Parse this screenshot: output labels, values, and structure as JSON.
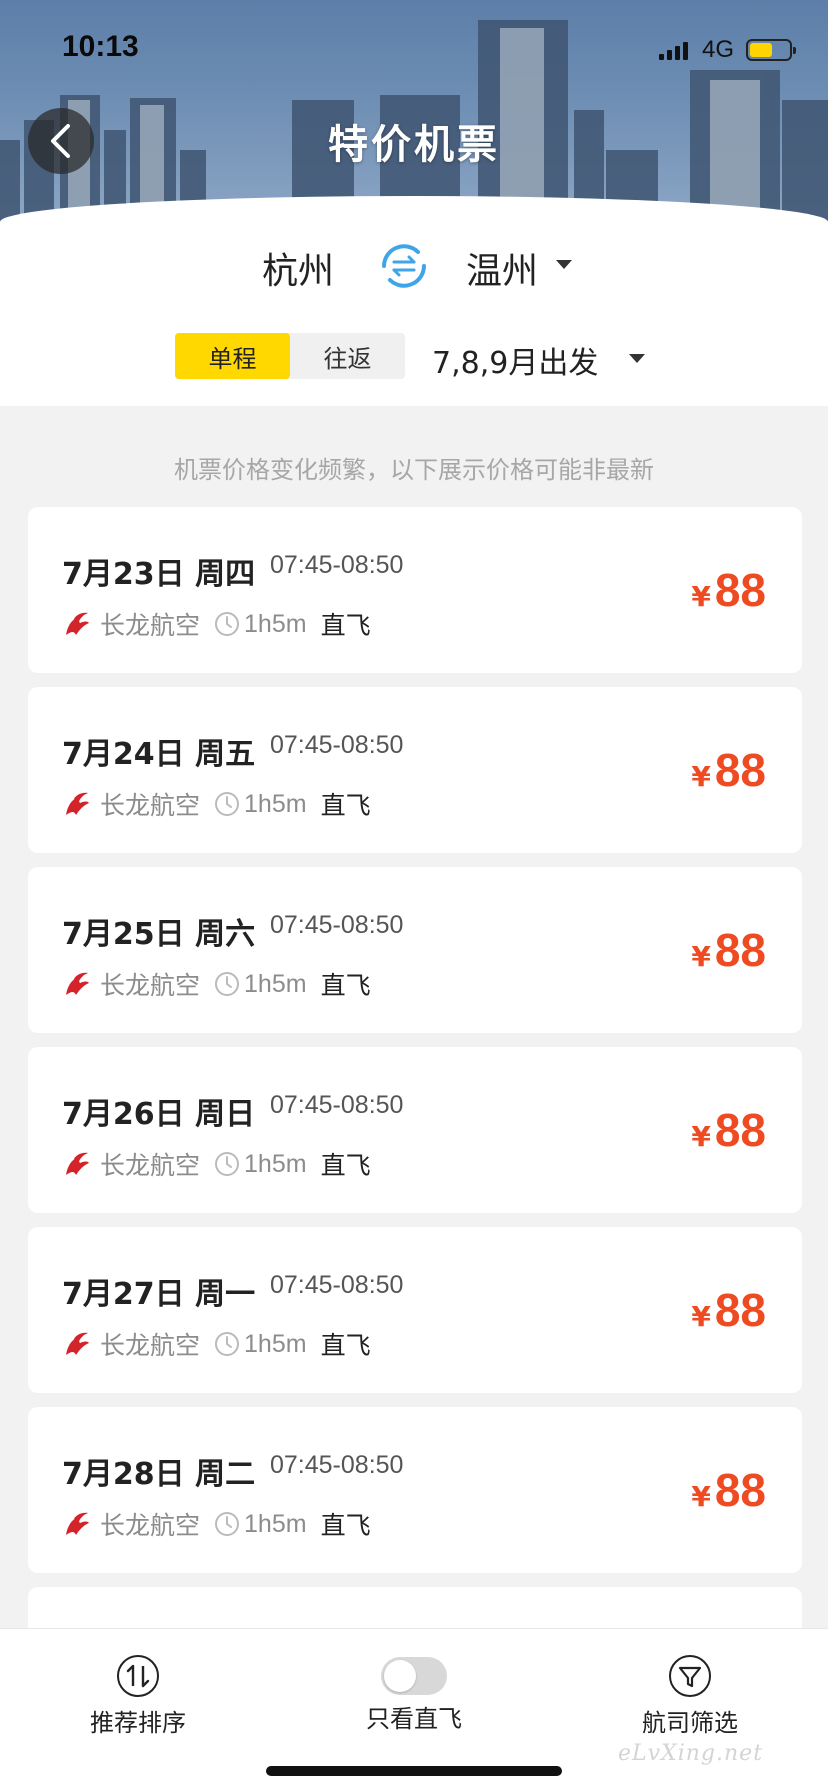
{
  "status_bar": {
    "time": "10:13",
    "network": "4G"
  },
  "header": {
    "title": "特价机票"
  },
  "route": {
    "from": "杭州",
    "to": "温州"
  },
  "trip_type": {
    "options": [
      "单程",
      "往返"
    ],
    "selected": "单程"
  },
  "departure": {
    "label": "7,8,9月出发"
  },
  "notice": "机票价格变化频繁，以下展示价格可能非最新",
  "flights": [
    {
      "date": "7月23日 周四",
      "time": "07:45-08:50",
      "airline": "长龙航空",
      "duration": "1h5m",
      "type": "直飞",
      "currency": "¥",
      "price": "88"
    },
    {
      "date": "7月24日 周五",
      "time": "07:45-08:50",
      "airline": "长龙航空",
      "duration": "1h5m",
      "type": "直飞",
      "currency": "¥",
      "price": "88"
    },
    {
      "date": "7月25日 周六",
      "time": "07:45-08:50",
      "airline": "长龙航空",
      "duration": "1h5m",
      "type": "直飞",
      "currency": "¥",
      "price": "88"
    },
    {
      "date": "7月26日 周日",
      "time": "07:45-08:50",
      "airline": "长龙航空",
      "duration": "1h5m",
      "type": "直飞",
      "currency": "¥",
      "price": "88"
    },
    {
      "date": "7月27日 周一",
      "time": "07:45-08:50",
      "airline": "长龙航空",
      "duration": "1h5m",
      "type": "直飞",
      "currency": "¥",
      "price": "88"
    },
    {
      "date": "7月28日 周二",
      "time": "07:45-08:50",
      "airline": "长龙航空",
      "duration": "1h5m",
      "type": "直飞",
      "currency": "¥",
      "price": "88"
    }
  ],
  "bottom_bar": {
    "sort_label": "推荐排序",
    "direct_only_label": "只看直飞",
    "direct_only_on": false,
    "filter_label": "航司筛选"
  },
  "watermark": "eLvXing.net",
  "colors": {
    "accent_yellow": "#ffd800",
    "price_red": "#ee4b22",
    "swap_blue": "#3ea6e8",
    "airline_red": "#d4242b"
  },
  "icons": [
    "back-arrow-icon",
    "swap-icon",
    "caret-down-icon",
    "airline-logo-icon",
    "clock-icon",
    "sort-icon",
    "filter-icon"
  ]
}
